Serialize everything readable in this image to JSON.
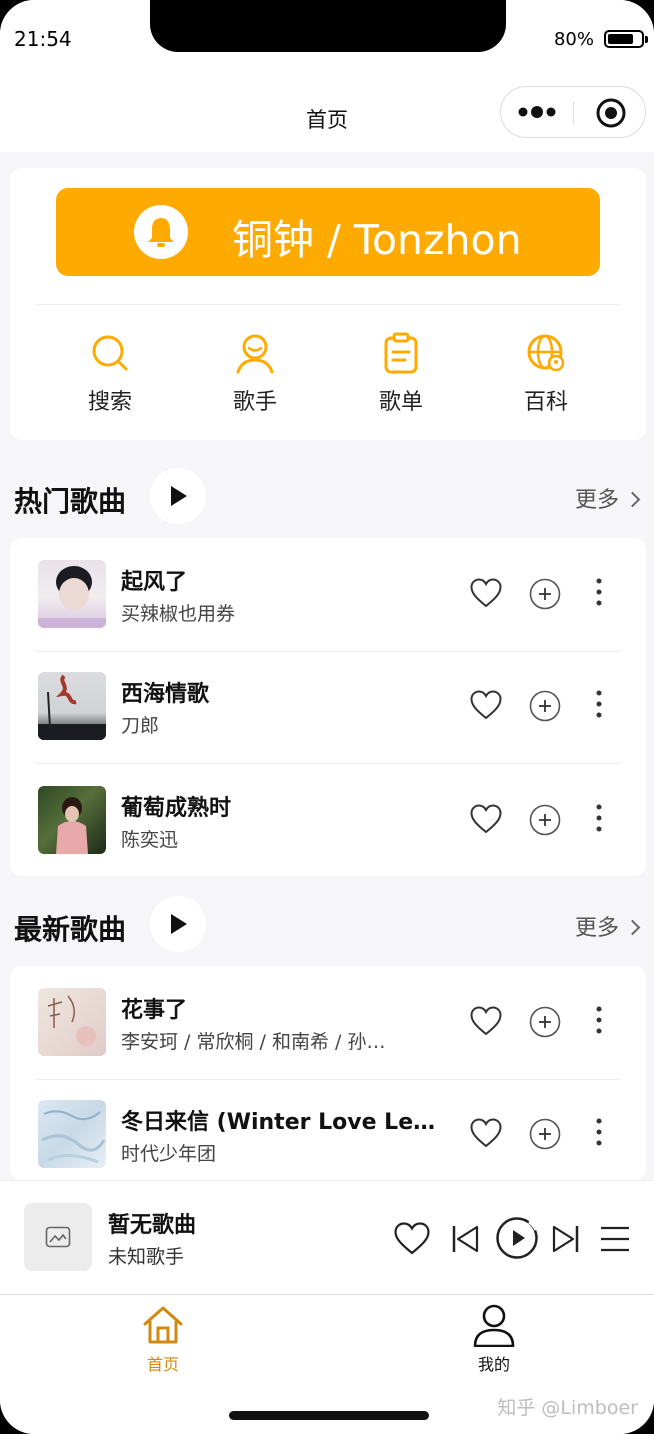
{
  "status_bar": {
    "time": "21:54",
    "battery": "80%",
    "battery_level": 0.8
  },
  "nav": {
    "title": "首页"
  },
  "banner": {
    "text": "铜钟 / Tonzhon",
    "color": "#ffaa00"
  },
  "quick_actions": [
    {
      "label": "搜索",
      "icon": "search-icon"
    },
    {
      "label": "歌手",
      "icon": "singer-icon"
    },
    {
      "label": "歌单",
      "icon": "playlist-icon"
    },
    {
      "label": "百科",
      "icon": "encyclopedia-icon"
    }
  ],
  "hot_songs": {
    "title": "热门歌曲",
    "more": "更多",
    "items": [
      {
        "title": "起风了",
        "artist": "买辣椒也用券"
      },
      {
        "title": "西海情歌",
        "artist": "刀郎"
      },
      {
        "title": "葡萄成熟时",
        "artist": "陈奕迅"
      }
    ]
  },
  "new_songs": {
    "title": "最新歌曲",
    "more": "更多",
    "items": [
      {
        "title": "花事了",
        "artist": "李安珂 / 常欣桐 / 和南希 / 孙…"
      },
      {
        "title": "冬日来信 (Winter Love Le…",
        "artist": "时代少年团"
      }
    ]
  },
  "player": {
    "title": "暂无歌曲",
    "artist": "未知歌手"
  },
  "tabs": [
    {
      "label": "首页",
      "active": true
    },
    {
      "label": "我的",
      "active": false
    }
  ],
  "watermark": "知乎 @Limboer",
  "colors": {
    "accent": "#ffaa00",
    "tab_active": "#d08a10"
  }
}
